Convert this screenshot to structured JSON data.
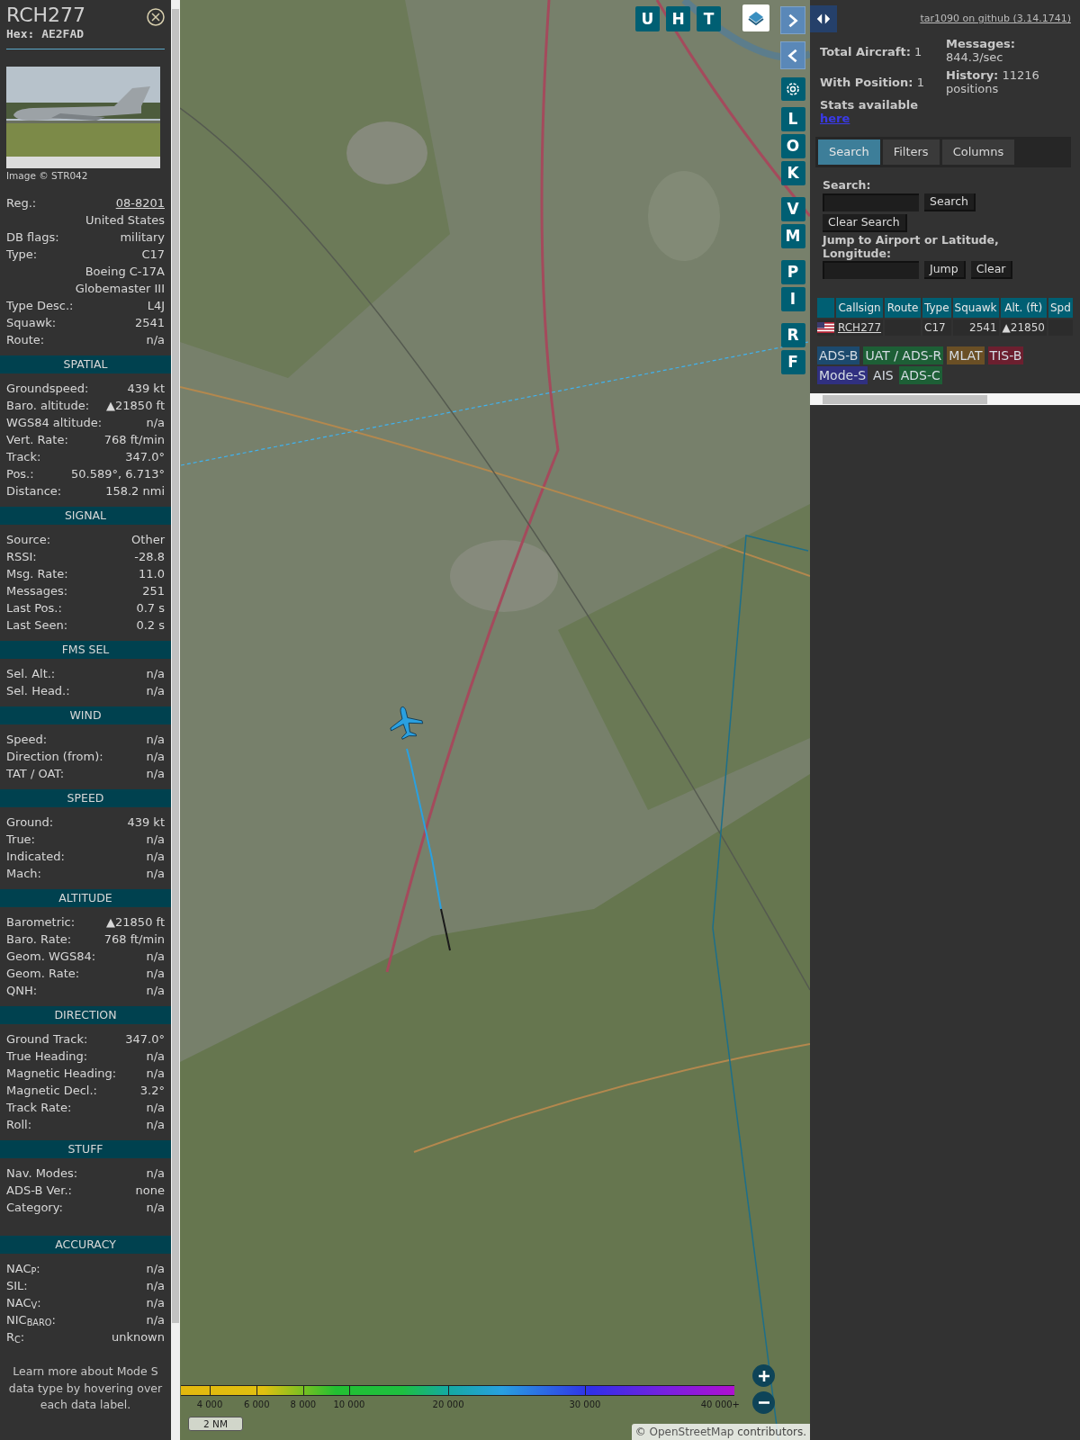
{
  "detail": {
    "callsign": "RCH277",
    "hex": "Hex: AE2FAD",
    "photo_credit": "Image © STR042",
    "rows": [
      {
        "label": "Reg.:",
        "value": "08-8201",
        "link": true
      },
      {
        "value": "United States"
      },
      {
        "label": "DB flags:",
        "value": "military"
      },
      {
        "label": "Type:",
        "value": "C17"
      },
      {
        "value": "Boeing C-17A Globemaster III"
      },
      {
        "label": "Type Desc.:",
        "value": "L4J"
      },
      {
        "label": "Squawk:",
        "value": "2541"
      },
      {
        "label": "Route:",
        "value": "n/a"
      }
    ],
    "sections": [
      {
        "title": "SPATIAL",
        "rows": [
          {
            "label": "Groundspeed:",
            "value": "439 kt"
          },
          {
            "label": "Baro. altitude:",
            "value": "▲21850 ft"
          },
          {
            "label": "WGS84 altitude:",
            "value": "n/a"
          },
          {
            "label": "Vert. Rate:",
            "value": "768 ft/min"
          },
          {
            "label": "Track:",
            "value": "347.0°"
          },
          {
            "label": "Pos.:",
            "value": "50.589°, 6.713°"
          },
          {
            "label": "Distance:",
            "value": "158.2 nmi"
          }
        ]
      },
      {
        "title": "SIGNAL",
        "rows": [
          {
            "label": "Source:",
            "value": "Other"
          },
          {
            "label": "RSSI:",
            "value": "-28.8"
          },
          {
            "label": "Msg. Rate:",
            "value": "11.0"
          },
          {
            "label": "Messages:",
            "value": "251"
          },
          {
            "label": "Last Pos.:",
            "value": "0.7 s"
          },
          {
            "label": "Last Seen:",
            "value": "0.2 s"
          }
        ]
      },
      {
        "title": "FMS SEL",
        "rows": [
          {
            "label": "Sel. Alt.:",
            "value": "n/a"
          },
          {
            "label": "Sel. Head.:",
            "value": "n/a"
          }
        ]
      },
      {
        "title": "WIND",
        "rows": [
          {
            "label": "Speed:",
            "value": "n/a"
          },
          {
            "label": "Direction (from):",
            "value": "n/a"
          },
          {
            "label": "TAT / OAT:",
            "value": "n/a"
          }
        ]
      },
      {
        "title": "SPEED",
        "rows": [
          {
            "label": "Ground:",
            "value": "439 kt"
          },
          {
            "label": "True:",
            "value": "n/a"
          },
          {
            "label": "Indicated:",
            "value": "n/a"
          },
          {
            "label": "Mach:",
            "value": "n/a"
          }
        ]
      },
      {
        "title": "ALTITUDE",
        "rows": [
          {
            "label": "Barometric:",
            "value": "▲21850 ft"
          },
          {
            "label": "Baro. Rate:",
            "value": "768 ft/min"
          },
          {
            "label": "Geom. WGS84:",
            "value": "n/a"
          },
          {
            "label": "Geom. Rate:",
            "value": "n/a"
          },
          {
            "label": "QNH:",
            "value": "n/a"
          }
        ]
      },
      {
        "title": "DIRECTION",
        "rows": [
          {
            "label": "Ground Track:",
            "value": "347.0°"
          },
          {
            "label": "True Heading:",
            "value": "n/a"
          },
          {
            "label": "Magnetic Heading:",
            "value": "n/a"
          },
          {
            "label": "Magnetic Decl.:",
            "value": "3.2°"
          },
          {
            "label": "Track Rate:",
            "value": "n/a"
          },
          {
            "label": "Roll:",
            "value": "n/a"
          }
        ]
      },
      {
        "title": "STUFF",
        "rows": [
          {
            "label": "Nav. Modes:",
            "value": "n/a"
          },
          {
            "label": "ADS-B Ver.:",
            "value": "none"
          },
          {
            "label": "Category:",
            "value": "n/a"
          }
        ]
      },
      {
        "title": "ACCURACY",
        "rows": [
          {
            "label": "NAC$_{P}$:",
            "value": "n/a"
          },
          {
            "label": "SIL:",
            "value": "n/a"
          },
          {
            "label": "NAC$_{V}$:",
            "value": "n/a"
          },
          {
            "label": "NIC$_{BARO}$:",
            "value": "n/a"
          },
          {
            "label": "R$_{C}$:",
            "value": "unknown"
          }
        ]
      }
    ],
    "note": "Learn more about Mode S data type by hovering over each data label."
  },
  "map": {
    "top_buttons": [
      "U",
      "H",
      "T"
    ],
    "side_groups": [
      [
        "L",
        "O",
        "K"
      ],
      [
        "V",
        "M"
      ],
      [
        "P",
        "I"
      ],
      [
        "R",
        "F"
      ]
    ],
    "altitude_legend": [
      "4 000",
      "6 000",
      "8 000",
      "10 000",
      "20 000",
      "30 000",
      "40 000+"
    ],
    "scale": "2 NM",
    "attribution": {
      "prefix": "© ",
      "link": "OpenStreetMap",
      "suffix": " contributors."
    }
  },
  "panel": {
    "github_link": "tar1090 on github (3.14.1741)",
    "stats_left": [
      {
        "label": "Total Aircraft:",
        "value": "1"
      },
      {
        "label": "With Position:",
        "value": "1"
      }
    ],
    "stats_right": [
      {
        "label": "Messages:",
        "value": "844.3/sec"
      },
      {
        "label": "History:",
        "value": "11216 positions"
      }
    ],
    "stats_note": {
      "text": "Stats available",
      "link": "here"
    },
    "tabs": [
      {
        "label": "Search",
        "selected": true
      },
      {
        "label": "Filters",
        "selected": false
      },
      {
        "label": "Columns",
        "selected": false
      }
    ],
    "search": {
      "label": "Search:",
      "search_button": "Search",
      "clear_button": "Clear Search",
      "jump_label": "Jump to Airport or Latitude, Longitude:",
      "jump_button": "Jump",
      "jump_clear_button": "Clear"
    },
    "table": {
      "columns": [
        "Callsign",
        "Route",
        "Type",
        "Squawk",
        "Alt. (ft)",
        "Spd"
      ],
      "rows": [
        {
          "callsign": "RCH277",
          "type": "C17",
          "squawk": "2541",
          "altitude": "▲21850"
        }
      ]
    },
    "legend": [
      {
        "label": "ADS-B",
        "color": "#1c4a6e"
      },
      {
        "label": "UAT / ADS-R",
        "color": "#1d5f36"
      },
      {
        "label": "MLAT",
        "color": "#6a4f25"
      },
      {
        "label": "TIS-B",
        "color": "#6c1f2f"
      },
      {
        "label": "Mode-S",
        "color": "#303080"
      },
      {
        "label": "AIS"
      },
      {
        "label": "ADS-C",
        "color": "#1d5f36"
      }
    ]
  }
}
